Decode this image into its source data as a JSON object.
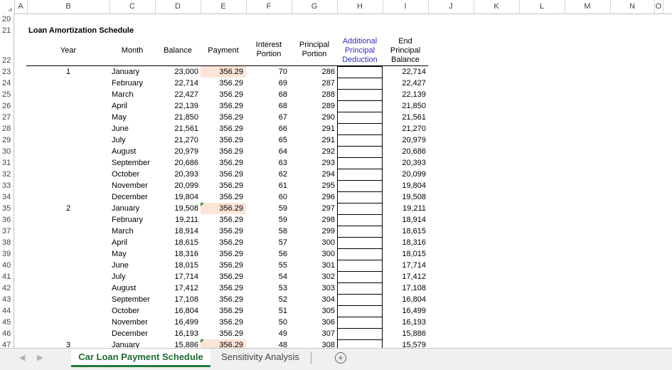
{
  "columns": [
    "A",
    "B",
    "C",
    "D",
    "E",
    "F",
    "G",
    "H",
    "I",
    "J",
    "K",
    "L",
    "M",
    "N",
    "O"
  ],
  "title": "Loan Amortization Schedule",
  "headers": {
    "year": "Year",
    "month": "Month",
    "balance": "Balance",
    "payment": "Payment",
    "interest": [
      "Interest",
      "Portion"
    ],
    "principal": [
      "Principal",
      "Portion"
    ],
    "additional": [
      "Additional",
      "Principal",
      "Deduction"
    ],
    "end": [
      "End",
      "Principal",
      "Balance"
    ]
  },
  "row_numbers": [
    "20",
    "21",
    "22",
    "23",
    "24",
    "25",
    "26",
    "27",
    "28",
    "29",
    "30",
    "31",
    "32",
    "33",
    "34",
    "35",
    "36",
    "37",
    "38",
    "39",
    "40",
    "41",
    "42",
    "43",
    "44",
    "45",
    "46",
    "47"
  ],
  "rows": [
    {
      "year": "1",
      "month": "January",
      "balance": "23,000",
      "payment": "356.29",
      "interest": "70",
      "principal": "286",
      "end": "22,714"
    },
    {
      "year": "",
      "month": "February",
      "balance": "22,714",
      "payment": "356.29",
      "interest": "69",
      "principal": "287",
      "end": "22,427"
    },
    {
      "year": "",
      "month": "March",
      "balance": "22,427",
      "payment": "356.29",
      "interest": "68",
      "principal": "288",
      "end": "22,139"
    },
    {
      "year": "",
      "month": "April",
      "balance": "22,139",
      "payment": "356.29",
      "interest": "68",
      "principal": "289",
      "end": "21,850"
    },
    {
      "year": "",
      "month": "May",
      "balance": "21,850",
      "payment": "356.29",
      "interest": "67",
      "principal": "290",
      "end": "21,561"
    },
    {
      "year": "",
      "month": "June",
      "balance": "21,561",
      "payment": "356.29",
      "interest": "66",
      "principal": "291",
      "end": "21,270"
    },
    {
      "year": "",
      "month": "July",
      "balance": "21,270",
      "payment": "356.29",
      "interest": "65",
      "principal": "291",
      "end": "20,979"
    },
    {
      "year": "",
      "month": "August",
      "balance": "20,979",
      "payment": "356.29",
      "interest": "64",
      "principal": "292",
      "end": "20,686"
    },
    {
      "year": "",
      "month": "September",
      "balance": "20,686",
      "payment": "356.29",
      "interest": "63",
      "principal": "293",
      "end": "20,393"
    },
    {
      "year": "",
      "month": "October",
      "balance": "20,393",
      "payment": "356.29",
      "interest": "62",
      "principal": "294",
      "end": "20,099"
    },
    {
      "year": "",
      "month": "November",
      "balance": "20,099",
      "payment": "356.29",
      "interest": "61",
      "principal": "295",
      "end": "19,804"
    },
    {
      "year": "",
      "month": "December",
      "balance": "19,804",
      "payment": "356.29",
      "interest": "60",
      "principal": "296",
      "end": "19,508"
    },
    {
      "year": "2",
      "month": "January",
      "balance": "19,508",
      "payment": "356.29",
      "interest": "59",
      "principal": "297",
      "end": "19,211"
    },
    {
      "year": "",
      "month": "February",
      "balance": "19,211",
      "payment": "356.29",
      "interest": "59",
      "principal": "298",
      "end": "18,914"
    },
    {
      "year": "",
      "month": "March",
      "balance": "18,914",
      "payment": "356.29",
      "interest": "58",
      "principal": "299",
      "end": "18,615"
    },
    {
      "year": "",
      "month": "April",
      "balance": "18,615",
      "payment": "356.29",
      "interest": "57",
      "principal": "300",
      "end": "18,316"
    },
    {
      "year": "",
      "month": "May",
      "balance": "18,316",
      "payment": "356.29",
      "interest": "56",
      "principal": "300",
      "end": "18,015"
    },
    {
      "year": "",
      "month": "June",
      "balance": "18,015",
      "payment": "356.29",
      "interest": "55",
      "principal": "301",
      "end": "17,714"
    },
    {
      "year": "",
      "month": "July",
      "balance": "17,714",
      "payment": "356.29",
      "interest": "54",
      "principal": "302",
      "end": "17,412"
    },
    {
      "year": "",
      "month": "August",
      "balance": "17,412",
      "payment": "356.29",
      "interest": "53",
      "principal": "303",
      "end": "17,108"
    },
    {
      "year": "",
      "month": "September",
      "balance": "17,108",
      "payment": "356.29",
      "interest": "52",
      "principal": "304",
      "end": "16,804"
    },
    {
      "year": "",
      "month": "October",
      "balance": "16,804",
      "payment": "356.29",
      "interest": "51",
      "principal": "305",
      "end": "16,499"
    },
    {
      "year": "",
      "month": "November",
      "balance": "16,499",
      "payment": "356.29",
      "interest": "50",
      "principal": "306",
      "end": "16,193"
    },
    {
      "year": "",
      "month": "December",
      "balance": "16,193",
      "payment": "356.29",
      "interest": "49",
      "principal": "307",
      "end": "15,886"
    },
    {
      "year": "3",
      "month": "January",
      "balance": "15,886",
      "payment": "356.29",
      "interest": "48",
      "principal": "308",
      "end": "15,579"
    }
  ],
  "tabs": {
    "active": "Car Loan Payment Schedule",
    "inactive": "Sensitivity Analysis",
    "add_icon": "+"
  },
  "nav_icons": {
    "prev": "◀",
    "next": "▶"
  },
  "colors": {
    "payment_fill": "#fce4d6",
    "header_blue": "#2e2ec8",
    "active_tab": "#1e6b30"
  }
}
